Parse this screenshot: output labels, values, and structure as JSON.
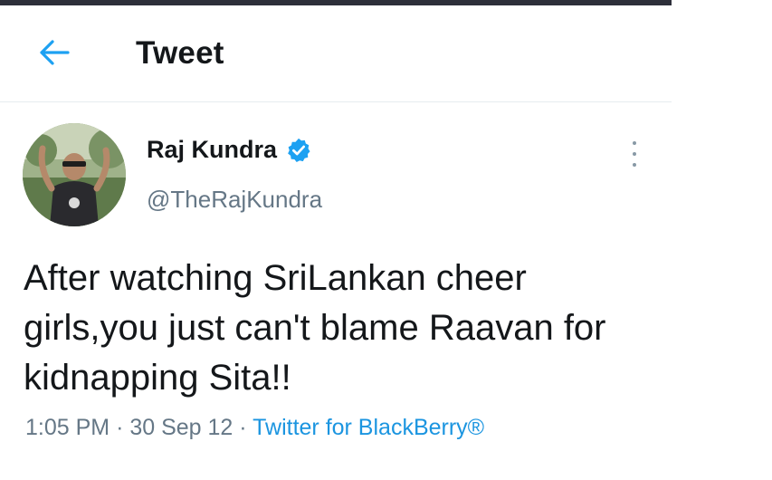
{
  "header": {
    "back_icon": "arrow-left-icon",
    "title": "Tweet"
  },
  "tweet": {
    "author": {
      "display_name": "Raj Kundra",
      "handle": "@TheRajKundra",
      "verified": true
    },
    "text": "After watching SriLankan cheer girls,you just can't blame Raavan for kidnapping Sita!!",
    "time": "1:05 PM",
    "separator": "·",
    "date": "30 Sep 12",
    "source": "Twitter for BlackBerry®"
  },
  "colors": {
    "accent": "#1da1f2",
    "text_primary": "#14171a",
    "text_secondary": "#657786",
    "link": "#1b95e0"
  }
}
